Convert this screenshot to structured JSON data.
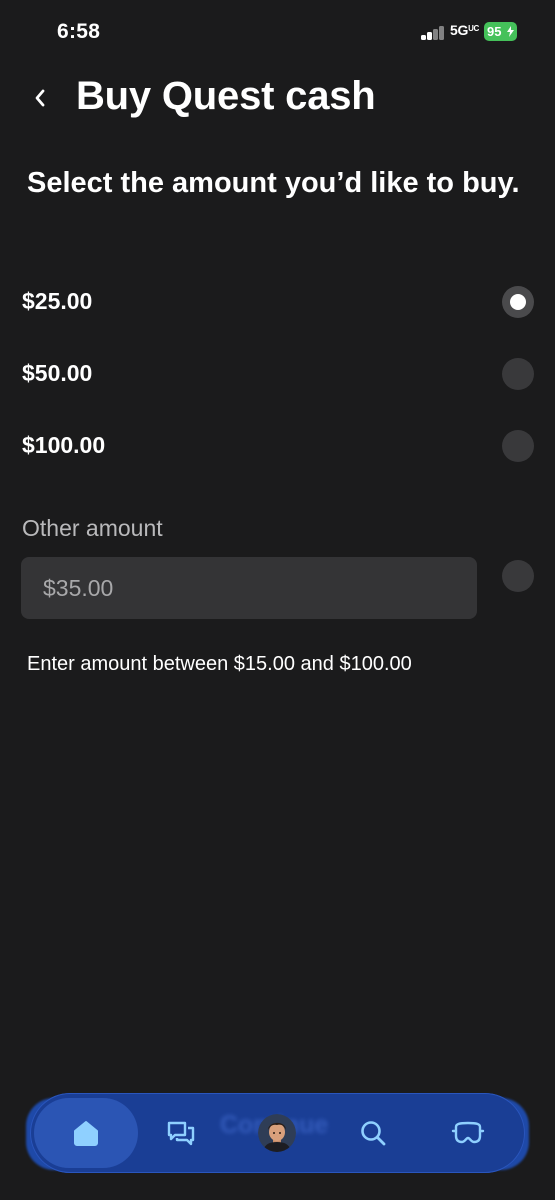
{
  "status_bar": {
    "time": "6:58",
    "network": "5G",
    "network_sub": "UC",
    "battery": "95"
  },
  "header": {
    "title": "Buy Quest cash"
  },
  "prompt": "Select the amount you’d like to buy.",
  "options": [
    {
      "label": "$25.00",
      "selected": true
    },
    {
      "label": "$50.00",
      "selected": false
    },
    {
      "label": "$100.00",
      "selected": false
    }
  ],
  "other_amount": {
    "label": "Other amount",
    "placeholder": "$35.00",
    "helper": "Enter amount between $15.00 and $100.00",
    "selected": false
  },
  "bottom_nav": {
    "ghost_text": "Continue",
    "items": [
      "home-icon",
      "chat-icon",
      "avatar",
      "search-icon",
      "headset-icon"
    ]
  },
  "colors": {
    "background": "#1b1b1c",
    "nav_background": "#1a3e95",
    "nav_icon": "#8fd0ff",
    "battery": "#45c15a"
  }
}
